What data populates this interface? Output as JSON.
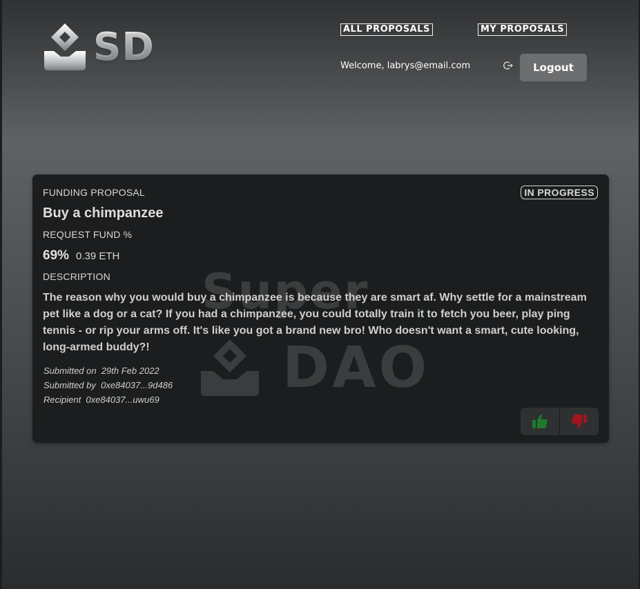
{
  "header": {
    "logo_text": "SD",
    "nav": {
      "all_proposals": "ALL PROPOSALS",
      "my_proposals": "MY PROPOSALS"
    },
    "welcome": "Welcome, labrys@email.com",
    "logout_label": "Logout"
  },
  "proposal": {
    "type_label": "FUNDING PROPOSAL",
    "status": "IN PROGRESS",
    "title": "Buy a chimpanzee",
    "request_fund_label": "REQUEST FUND %",
    "fund_percent": "69%",
    "fund_amount": "0.39 ETH",
    "description_label": "DESCRIPTION",
    "description": "The reason why you would buy a chimpanzee is because they are smart af. Why settle for a mainstream pet like a dog or a cat? If you had a chimpanzee, you could totally train it to fetch you beer, play ping tennis - or rip your arms off. It's like you got a brand new bro! Who doesn't want a smart, cute looking, long-armed buddy?!",
    "submitted_on": "Submitted on  29th Feb 2022",
    "submitted_by": "Submitted by  0xe84037...9d486",
    "recipient": "Recipient  0xe84037...uwu69",
    "watermark_top": "Super",
    "watermark_bottom": "DAO"
  },
  "colors": {
    "vote_up": "#1e7a2e",
    "vote_down": "#a3151e"
  }
}
